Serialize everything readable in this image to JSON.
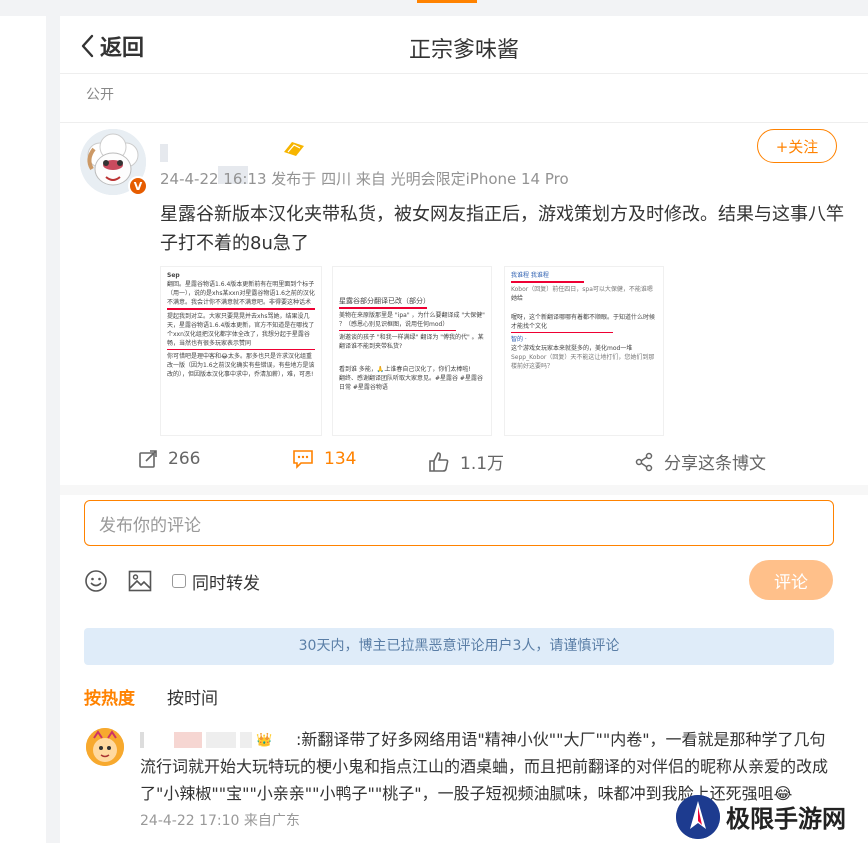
{
  "header": {
    "back_label": "返回",
    "title": "正宗爹味酱"
  },
  "post": {
    "visibility": "公开",
    "follow_label": "+关注",
    "meta": "24-4-22 16:13 发布于 四川 来自 光明会限定iPhone 14 Pro",
    "verified_badge": "V",
    "text": "星露谷新版本汉化夹带私货，被女网友指正后，游戏策划方及时修改。结果与这事八竿子打不着的8u急了",
    "images": [
      {
        "lines": [
          "Sep",
          "翻回。星露谷物语1.6.4版本更新前有在明里面到个标子（用一），说的是xhs某xxn对星露谷物语1.6之前的汉化不满意。我会计你不满意就不满意吧。非得要这种话术",
          "提起我到对立。大家只要晃晃并去xhs骂她，结果没几天，星露谷物语1.6.4版本更新，官方不知道是在哪找了个xxn汉化组把汉化都字体全改了，我想分起于星露谷畅，当然也有很多玩家表示赞同",
          "你可惜吧是理中客和😂太多。那多也只是许求汉化组重改一版（因为1.6之前汉化确实有些错误，有些地方是该改的），但因版本汉化事中求中，乔清加薪），难，可恶!"
        ]
      },
      {
        "lines": [
          "星露谷部分翻译已改（部分）",
          "美物在来原版那里是 \"ipa\" ，为什么要翻译成 \"大保健\" ？（感恩心别见识框图，说用任何mod）",
          "谢邀谈的孩子 \"和我一样满绿\" 翻译为 \"傅我的代\" 。某翻译谁不能到夹带私货?",
          "看到谁 多能，🙏上谁春自己汉化了，你们太棒啦!",
          "翻终、感谢翻译团队听取大家意见。#星露谷 #星露谷日常 #星露谷物语"
        ]
      },
      {
        "lines": [
          "我谁程 我谁程",
          "Kobor（回复）前任四日，spa可以大保健，不能谁嗯",
          "她给",
          "喔呀，这个新翻译哪哪有着都不顺眼。于知道什么时候才能找个文化",
          "智的 ·",
          "这个游戏女玩家本来就挺多的，美化mod一堆",
          "Sepp_Kobor（回复）天不能这让地打们，您她们到那楼前好这要吗？"
        ]
      }
    ]
  },
  "actions": {
    "repost": "266",
    "comment": "134",
    "like": "1.1万",
    "share": "分享这条博文"
  },
  "composer": {
    "placeholder": "发布你的评论",
    "repost_label": "同时转发",
    "submit_label": "评论"
  },
  "notice": "30天内，博主已拉黑恶意评论用户3人，请谨慎评论",
  "sort": {
    "hot": "按热度",
    "time": "按时间"
  },
  "comment": {
    "text": ":新翻译带了好多网络用语\"精神小伙\"\"大厂\"\"内卷\"，一看就是那种学了几句流行词就开始大玩特玩的梗小鬼和指点江山的酒桌蛐，而且把前翻译的对伴侣的昵称从亲爱的改成了\"小辣椒\"\"宝\"\"小亲亲\"\"小鸭子\"\"桃子\"，一股子短视频油腻味，味都冲到我脸上还死强咀😂",
    "meta": "24-4-22 17:10 来自广东"
  },
  "watermark": {
    "text": "极限手游网"
  },
  "colors": {
    "accent": "#ff8200",
    "notice_bg": "#dfecf9"
  }
}
